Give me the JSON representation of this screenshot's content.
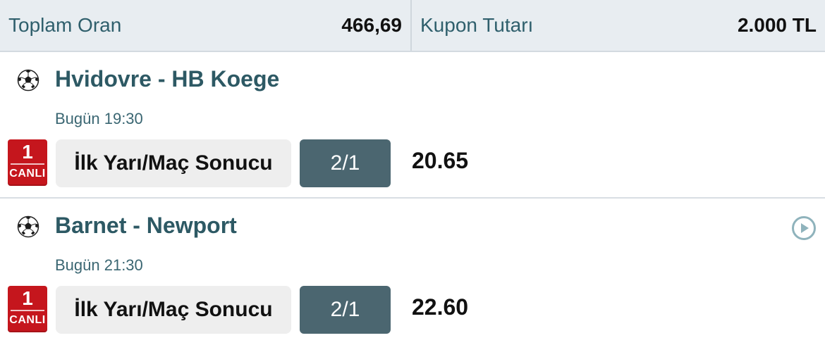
{
  "summary": {
    "total_odds_label": "Toplam Oran",
    "total_odds_value": "466,69",
    "stake_label": "Kupon Tutarı",
    "stake_value": "2.000 TL"
  },
  "matches": [
    {
      "icon": "soccer-ball-icon",
      "teams": "Hvidovre - HB Koege",
      "time": "Bugün 19:30",
      "live_number": "1",
      "live_label": "CANLI",
      "market": "İlk Yarı/Maç Sonucu",
      "pick": "2/1",
      "odds": "20.65"
    },
    {
      "icon": "soccer-ball-icon",
      "teams": "Barnet - Newport",
      "time": "Bugün 21:30",
      "live_number": "1",
      "live_label": "CANLI",
      "market": "İlk Yarı/Maç Sonucu",
      "pick": "2/1",
      "odds": "22.60",
      "action_icon": "play-circle-icon"
    }
  ],
  "colors": {
    "header_bg": "#e8edf1",
    "title_teal": "#2d5964",
    "live_red": "#c5161d",
    "pick_bg": "#4b6670",
    "market_bg": "#eeeeee"
  }
}
